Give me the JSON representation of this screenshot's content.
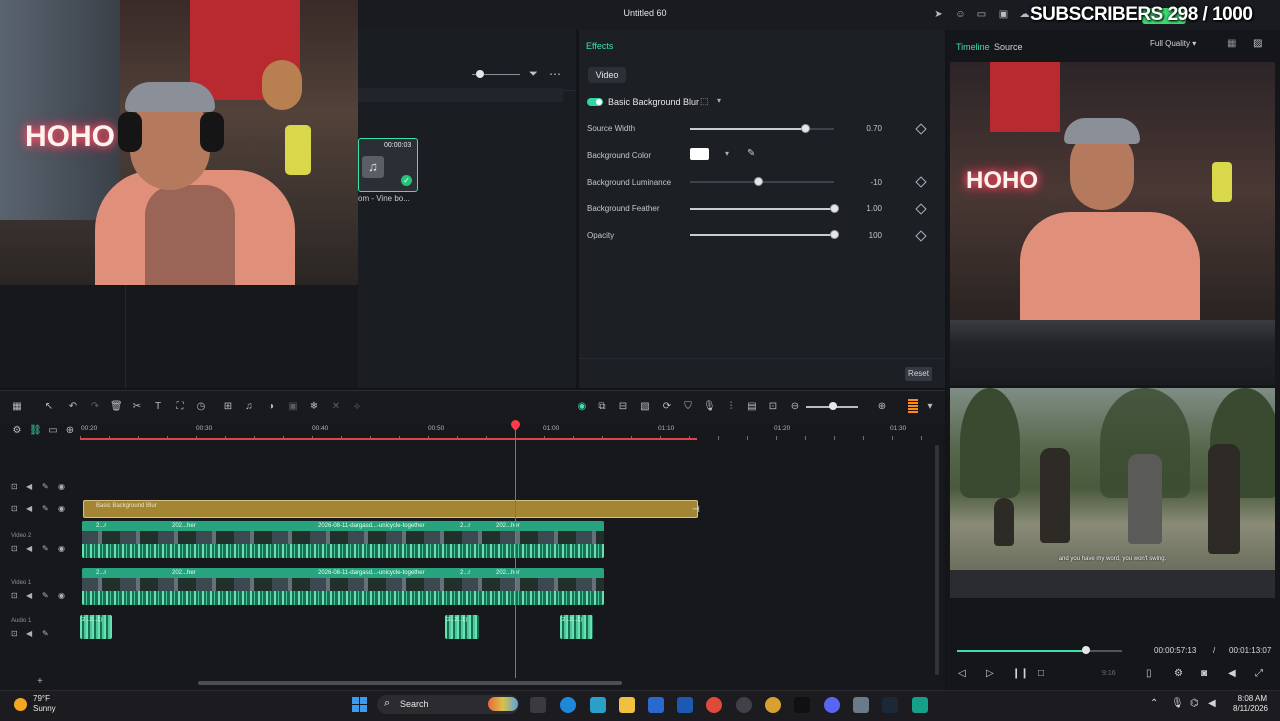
{
  "title_bar": {
    "title": "Untitled 60",
    "overlay": "SUBSCRIBERS 298 / 1000"
  },
  "media": {
    "thumb_duration": "00:00:03",
    "thumb_label": "om - Vine bo..."
  },
  "effects": {
    "panel_title": "Effects",
    "tab": "Video",
    "effect_name": "Basic Background Blur",
    "params": [
      {
        "label": "Source Width",
        "value": "0.70",
        "level": 0.8
      },
      {
        "label": "Background Color",
        "color": "#ffffff"
      },
      {
        "label": "Background Luminance",
        "value": "-10",
        "level": 0.47
      },
      {
        "label": "Background Feather",
        "value": "1.00",
        "level": 1.0
      },
      {
        "label": "Opacity",
        "value": "100",
        "level": 1.0
      }
    ],
    "reset_label": "Reset"
  },
  "preview": {
    "tab_timeline": "Timeline",
    "tab_source": "Source",
    "quality": "Full Quality",
    "current_time": "00:00:57:13",
    "separator": "/",
    "total_time": "00:01:13:07",
    "progress": 0.78,
    "ratio": "9:16",
    "subtitle": "and you have my word, you won't swing."
  },
  "timeline": {
    "ruler_labels": [
      "00:20",
      "00:30",
      "00:40",
      "00:50",
      "01:00",
      "01:10",
      "01:20",
      "01:30"
    ],
    "tracks": {
      "video2": "Video 2",
      "video1": "Video 1",
      "audio1": "Audio 1"
    },
    "effect_clip_label": "Basic Background Blur",
    "video_clip_labels": [
      "2...r",
      "202...her",
      "2026-08-11-dargasd...-unicycle-together",
      "2...r",
      "202...her"
    ],
    "audio_clip_labels": [
      "2...2...1)",
      "2...2...1)",
      "2...2...1)"
    ]
  },
  "taskbar": {
    "temperature": "79°F",
    "weather": "Sunny",
    "search_placeholder": "Search",
    "time": "8:08 AM",
    "date": "8/11/2026"
  },
  "colors": {
    "accent": "#3fe0b0",
    "playhead": "#ff3b4a",
    "effect_clip": "#a38533",
    "video_clip": "#1f8f6e"
  }
}
